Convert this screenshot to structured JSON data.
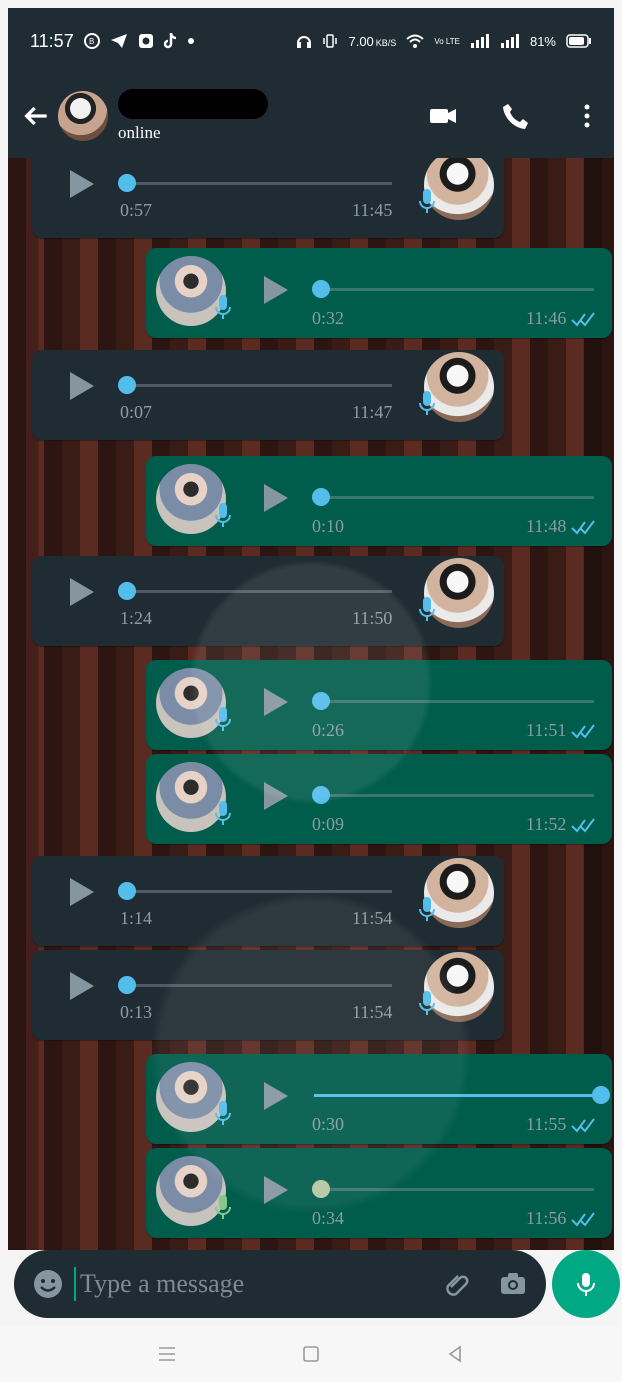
{
  "status_bar": {
    "time": "11:57",
    "net_speed_value": "7.00",
    "net_speed_unit": "KB/S",
    "volte": "Vo LTE",
    "battery": "81%"
  },
  "header": {
    "status": "online"
  },
  "messages": [
    {
      "type": "incoming",
      "duration": "0:57",
      "time": "11:45"
    },
    {
      "type": "outgoing",
      "duration": "0:32",
      "time": "11:46"
    },
    {
      "type": "incoming",
      "duration": "0:07",
      "time": "11:47"
    },
    {
      "type": "outgoing",
      "duration": "0:10",
      "time": "11:48"
    },
    {
      "type": "incoming",
      "duration": "1:24",
      "time": "11:50"
    },
    {
      "type": "outgoing",
      "duration": "0:26",
      "time": "11:51"
    },
    {
      "type": "outgoing",
      "duration": "0:09",
      "time": "11:52"
    },
    {
      "type": "incoming",
      "duration": "1:14",
      "time": "11:54"
    },
    {
      "type": "incoming",
      "duration": "0:13",
      "time": "11:54"
    },
    {
      "type": "outgoing",
      "duration": "0:30",
      "time": "11:55",
      "playback_progress": 1.0
    },
    {
      "type": "outgoing",
      "duration": "0:34",
      "time": "11:56",
      "unplayed": true
    }
  ],
  "composer": {
    "placeholder": "Type a message"
  },
  "colors": {
    "header_bg": "#1f2c34",
    "incoming_bubble": "#202c33",
    "outgoing_bubble": "#005c4b",
    "accent_blue": "#53bdeb",
    "accent_green": "#00a884"
  },
  "icons": {
    "back": "arrow-left-icon",
    "video_call": "video-camera-icon",
    "voice_call": "phone-icon",
    "menu": "more-vert-icon",
    "emoji": "emoji-icon",
    "attach": "paperclip-icon",
    "camera": "camera-icon",
    "voice_record": "microphone-icon"
  }
}
